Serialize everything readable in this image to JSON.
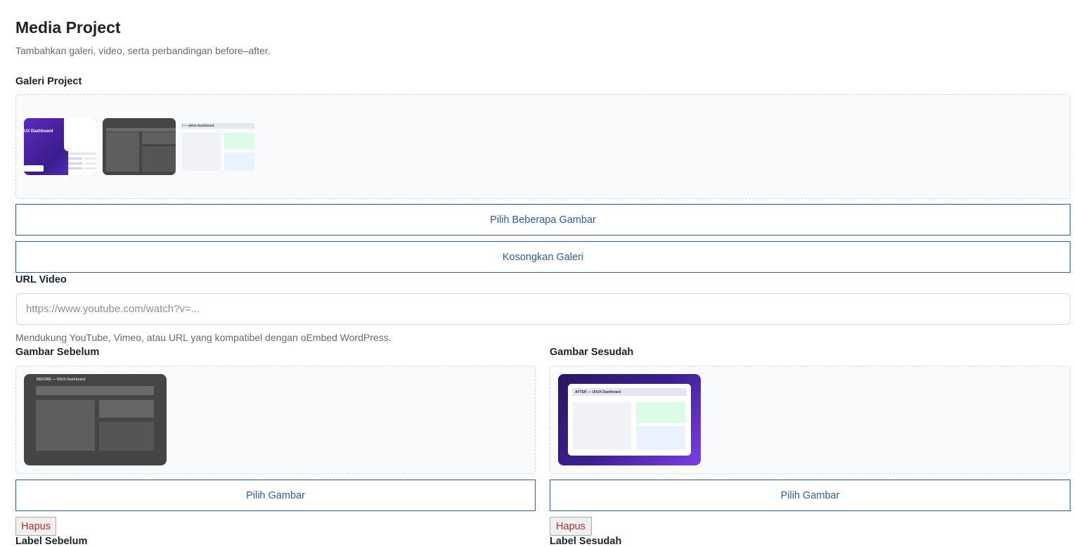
{
  "header": {
    "title": "Media Project",
    "subtitle": "Tambahkan galeri, video, serta perbandingan before–after."
  },
  "gallery": {
    "label": "Galeri Project",
    "thumb1_text": "UX Dashboard",
    "thumb3_text": "r — UI/UX Dashboard",
    "select_button": "Pilih Beberapa Gambar",
    "clear_button": "Kosongkan Galeri"
  },
  "video": {
    "label": "URL Video",
    "value": "",
    "placeholder": "https://www.youtube.com/watch?v=...",
    "help": "Mendukung YouTube, Vimeo, atau URL yang kompatibel dengan oEmbed WordPress."
  },
  "before": {
    "label": "Gambar Sebelum",
    "image_text": "BEFORE — UI/UX Dashboard",
    "select_button": "Pilih Gambar",
    "remove_button": "Hapus",
    "next_label": "Label Sebelum"
  },
  "after": {
    "label": "Gambar Sesudah",
    "image_text": "AFTER — UI/UX Dashboard",
    "select_button": "Pilih Gambar",
    "remove_button": "Hapus",
    "next_label": "Label Sesudah"
  },
  "colors": {
    "accent": "#2f5aa8",
    "danger": "#b32d2e",
    "purple": "#5b2bbf"
  }
}
